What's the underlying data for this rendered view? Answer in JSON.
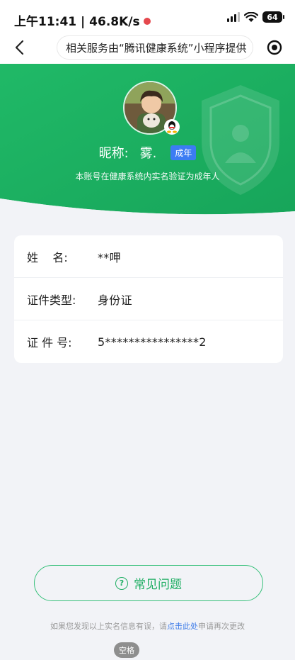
{
  "status_bar": {
    "time": "上午11:41 | 46.8K/s",
    "battery": "64"
  },
  "nav": {
    "title": "相关服务由“腾讯健康系统”小程序提供"
  },
  "profile": {
    "nickname_label": "昵称:",
    "nickname": "雾.",
    "badge": "成年",
    "note": "本账号在健康系统内实名验证为成年人"
  },
  "info": {
    "rows": [
      {
        "label": "姓    名:",
        "value": "**呷"
      },
      {
        "label": "证件类型:",
        "value": "身份证"
      },
      {
        "label": "证 件 号:",
        "value": "5****************2"
      }
    ]
  },
  "faq": {
    "label": "常见问题"
  },
  "footer": {
    "prefix": "如果您发现以上实名信息有误，请",
    "link": "点击此处",
    "suffix": "申请再次更改"
  },
  "keyboard_hint": {
    "label": "空格"
  },
  "colors": {
    "brand_green": "#1fae63",
    "badge_blue": "#3c7cf3",
    "link_blue": "#3d7be8"
  }
}
